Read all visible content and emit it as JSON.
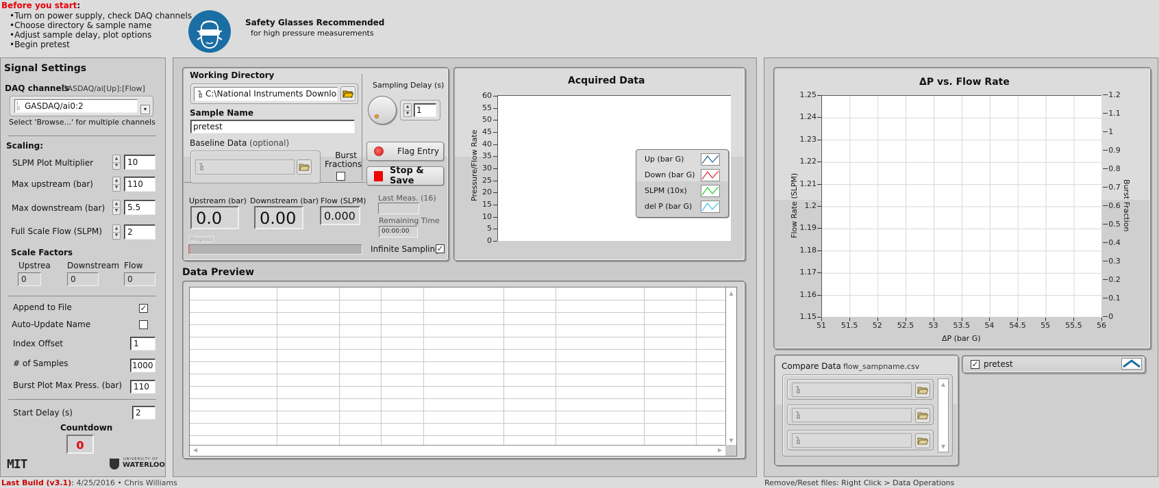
{
  "header": {
    "before_title": "Before you start",
    "before_colon": ":",
    "steps": [
      "•Turn on power supply, check DAQ channels",
      "•Choose directory & sample name",
      "•Adjust sample delay, plot options",
      "•Begin pretest"
    ],
    "safety_title": "Safety Glasses Recommended",
    "safety_sub": "for high pressure measurements",
    "safety_icon": "safety-glasses-icon",
    "accent_red": "#e8000b",
    "safety_blue": "#1b6ea4"
  },
  "signal_settings": {
    "title": "Signal Settings",
    "daq_label": "DAQ channels",
    "daq_hint": "GASDAQ/ai[Up]:[Flow]",
    "daq_value": "GASDAQ/ai0:2",
    "daq_note": "Select 'Browse...' for multiple channels",
    "scaling_title": "Scaling:",
    "slpm_multiplier_label": "SLPM Plot Multiplier",
    "slpm_multiplier_value": "10",
    "max_upstream_label": "Max upstream (bar)",
    "max_upstream_value": "110",
    "max_downstream_label": "Max downstream (bar)",
    "max_downstream_value": "5.5",
    "full_scale_flow_label": "Full Scale Flow (SLPM)",
    "full_scale_flow_value": "2",
    "scale_factors_title": "Scale Factors",
    "sf_upstream_label": "Upstrea",
    "sf_upstream_value": "0",
    "sf_downstream_label": "Downstream",
    "sf_downstream_value": "0",
    "sf_flow_label": "Flow",
    "sf_flow_value": "0",
    "append_label": "Append to File",
    "append_checked": "✓",
    "auto_update_label": "Auto-Update Name",
    "auto_update_checked": "",
    "index_offset_label": "Index Offset",
    "index_offset_value": "1",
    "num_samples_label": "# of Samples",
    "num_samples_value": "1000",
    "burst_max_label": "Burst Plot Max Press. (bar)",
    "burst_max_value": "110",
    "start_delay_label": "Start Delay (s)",
    "start_delay_value": "2",
    "countdown_label": "Countdown",
    "countdown_value": "0",
    "logo_left": "MIT",
    "logo_right_small": "UNIVERSITY OF",
    "logo_right_big": "WATERLOO"
  },
  "acquisition": {
    "working_dir_label": "Working Directory",
    "working_dir_value": "C:\\National Instruments Downloads",
    "sample_name_label": "Sample Name",
    "sample_name_value": "pretest",
    "baseline_label": "Baseline Data",
    "baseline_optional": "(optional)",
    "baseline_value": "",
    "burst_fractions_label_1": "Burst",
    "burst_fractions_label_2": "Fractions",
    "burst_fractions_checked": "",
    "sampling_delay_label": "Sampling Delay (s)",
    "sampling_delay_value": "1",
    "flag_entry_label": "Flag Entry",
    "stop_save_label": "Stop & Save",
    "upstream_label": "Upstream (bar)",
    "upstream_value": "0.0",
    "downstream_label": "Downstream (bar)",
    "downstream_value": "0.00",
    "flow_label": "Flow (SLPM)",
    "flow_value": "0.000",
    "last_meas_label": "Last Meas. (16)",
    "last_meas_value": "",
    "remaining_label": "Remaining Time",
    "remaining_value": "00:00:00",
    "progress_label": "Progress",
    "progress_fraction": 0.0,
    "infinite_label": "Infinite Sampling",
    "infinite_checked": "✓"
  },
  "acquired_chart": {
    "title": "Acquired Data",
    "ylabel": "Pressure/Flow Rate",
    "legend": [
      {
        "label": "Up (bar G)",
        "color": "#1f5f8f"
      },
      {
        "label": "Down (bar G)",
        "color": "#e8202a"
      },
      {
        "label": "SLPM (10x)",
        "color": "#19d119"
      },
      {
        "label": "del P (bar G)",
        "color": "#35c3ea"
      }
    ]
  },
  "data_preview": {
    "title": "Data Preview",
    "columns": 9,
    "rows": 13
  },
  "burst_chart": {
    "title": "ΔP vs. Flow Rate",
    "xlabel": "ΔP (bar G)",
    "ylabel_left": "Flow Rate (SLPM)",
    "ylabel_right": "Burst Fraction"
  },
  "compare": {
    "title": "Compare Data",
    "file_hint": "flow_sampname.csv",
    "files": [
      "",
      "",
      ""
    ]
  },
  "plot_legend": {
    "label": "pretest",
    "checked": "✓",
    "color": "#1b6ea4"
  },
  "footer": {
    "build_label": "Last Build (v3.1)",
    "build_colon": ":",
    "build_info": " 4/25/2016 • Chris Williams",
    "remove_hint": "Remove/Reset files: Right Click > Data Operations"
  },
  "chart_data": [
    {
      "type": "line",
      "title": "Acquired Data",
      "xlabel": "",
      "ylabel": "Pressure/Flow Rate",
      "ylim": [
        0,
        60
      ],
      "yticks": [
        0,
        5,
        10,
        15,
        20,
        25,
        30,
        35,
        40,
        45,
        50,
        55,
        60
      ],
      "grid": false,
      "legend_position": "right",
      "series": [
        {
          "name": "Up (bar G)",
          "values": []
        },
        {
          "name": "Down (bar G)",
          "values": []
        },
        {
          "name": "SLPM (10x)",
          "values": []
        },
        {
          "name": "del P (bar G)",
          "values": []
        }
      ]
    },
    {
      "type": "scatter",
      "title": "ΔP vs. Flow Rate",
      "xlabel": "ΔP (bar G)",
      "ylabel": "Flow Rate (SLPM)",
      "y2label": "Burst Fraction",
      "xlim": [
        51,
        56
      ],
      "ylim": [
        1.15,
        1.25
      ],
      "y2lim": [
        0,
        1.2
      ],
      "xticks": [
        "51",
        "51.5",
        "52",
        "52.5",
        "53",
        "53.5",
        "54",
        "54.5",
        "55",
        "55.5",
        "56"
      ],
      "yticks": [
        "1.15",
        "1.16",
        "1.17",
        "1.18",
        "1.19",
        "1.2",
        "1.21",
        "1.22",
        "1.23",
        "1.24",
        "1.25"
      ],
      "y2ticks": [
        "0",
        "0.1",
        "0.2",
        "0.3",
        "0.4",
        "0.5",
        "0.6",
        "0.7",
        "0.8",
        "0.9",
        "1",
        "1.1",
        "1.2"
      ],
      "grid": true,
      "legend_position": "below-right",
      "series": [
        {
          "name": "pretest",
          "values": []
        }
      ]
    }
  ]
}
